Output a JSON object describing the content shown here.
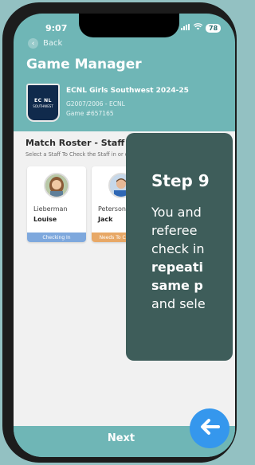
{
  "status": {
    "time": "9:07",
    "battery": "78"
  },
  "nav": {
    "back_label": "Back"
  },
  "page": {
    "title": "Game Manager"
  },
  "team": {
    "logo_text": "EC NL",
    "logo_sub": "SOUTHWEST",
    "name": "ECNL Girls Southwest 2024-25",
    "division": "G2007/2006 - ECNL",
    "game": "Game #657165"
  },
  "roster": {
    "title": "Match Roster - Staff",
    "subtitle": "Select a Staff To Check the Staff in or change Status",
    "staff": [
      {
        "last_name": "Lieberman",
        "first_name": "Louise",
        "status": "Checking In",
        "status_color": "#7ea8dd"
      },
      {
        "last_name": "Peterson",
        "first_name": "Jack",
        "status": "Needs To Check In",
        "status_color": "#e8a866"
      }
    ]
  },
  "tutorial": {
    "step_title": "Step 9",
    "body_lines": [
      "You and",
      "referee",
      "check in",
      "repeati",
      "same p",
      "and sele"
    ]
  },
  "footer": {
    "next_label": "Next"
  },
  "colors": {
    "teal": "#6fb6b6",
    "overlay": "#3e5d5a",
    "fab": "#3597ed"
  },
  "icons": {
    "back": "chevron-left-icon",
    "signal": "signal-bars-icon",
    "wifi": "wifi-icon",
    "fab": "arrow-left-icon"
  }
}
